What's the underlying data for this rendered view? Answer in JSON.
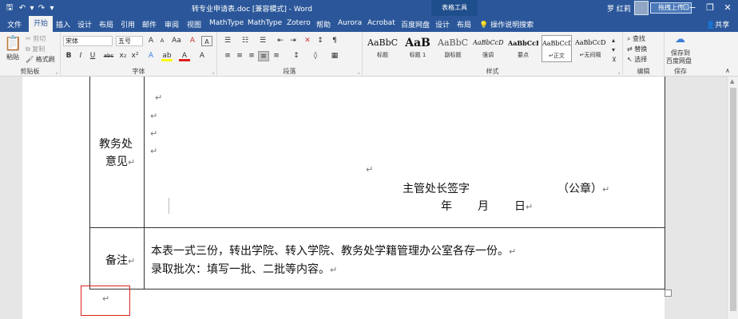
{
  "titlebar": {
    "doc_title": "转专业申请表.doc [兼容模式] - Word",
    "context_title": "表格工具",
    "user": "罗 红莉",
    "upload": "拖拽上传",
    "min": "−",
    "restore": "❐",
    "max": "□",
    "close": "✕"
  },
  "qat": {
    "save": "🖫",
    "undo": "↶",
    "undo_dd": "▾",
    "redo": "↷",
    "customize": "▾"
  },
  "tabs": [
    "文件",
    "开始",
    "插入",
    "设计",
    "布局",
    "引用",
    "邮件",
    "审阅",
    "视图",
    "MathType",
    "MathType",
    "Zotero",
    "帮助",
    "Aurora",
    "Acrobat",
    "百度网盘",
    "设计",
    "布局"
  ],
  "tell_me": "操作说明搜索",
  "share": "共享",
  "clipboard": {
    "paste": "粘贴",
    "cut": "剪切",
    "copy": "复制",
    "format_painter": "格式刷",
    "label": "剪贴板"
  },
  "font": {
    "name": "宋体",
    "size": "五号",
    "label": "字体",
    "grow": "A",
    "shrink": "A",
    "clear": "A",
    "bold": "B",
    "italic": "I",
    "underline": "U",
    "strike": "abc",
    "sub": "x₂",
    "sup": "x²",
    "effects": "A",
    "highlight": "ab",
    "color": "A",
    "aa": "Aa",
    "char": "A"
  },
  "paragraph": {
    "label": "段落",
    "bullets": "☰",
    "numbering": "☷",
    "multilevel": "☰",
    "dec_indent": "⇤",
    "inc_indent": "⇥",
    "sort": "↕",
    "marks": "¶",
    "al_left": "≡",
    "al_center": "≡",
    "al_right": "≡",
    "justify": "≡",
    "distrib": "≡",
    "spacing": "↕",
    "shading": "◊",
    "border": "▦",
    "x": "✕"
  },
  "styles": {
    "label": "样式",
    "items": [
      {
        "sample": "AaBbC",
        "name": "标题"
      },
      {
        "sample": "AaB",
        "name": "标题 1"
      },
      {
        "sample": "AaBbC",
        "name": "副标题"
      },
      {
        "sample": "AaBbCcD",
        "name": "强调"
      },
      {
        "sample": "AaBbCcE",
        "name": "要点"
      },
      {
        "sample": "AaBbCcD",
        "name": "↵正文"
      },
      {
        "sample": "AaBbCcD",
        "name": "↵无间隔"
      }
    ],
    "up": "▴",
    "down": "▾",
    "more": "⊻"
  },
  "editing": {
    "label": "编辑",
    "find": "查找",
    "replace": "替换",
    "select": "选择"
  },
  "save": {
    "label": "保存",
    "line1": "保存到",
    "line2": "百度网盘"
  },
  "table": {
    "dean_label_1": "教务处",
    "dean_label_2": "意见",
    "signature": "主管处长签字",
    "seal": "（公章）",
    "date_year": "年",
    "date_month": "月",
    "date_day": "日",
    "remark_label": "备注",
    "remark_line1": "本表一式三份，转出学院、转入学院、教务处学籍管理办公室各存一份。",
    "remark_line2": "录取批次：填写一批、二批等内容。"
  },
  "marks": {
    "pm": "↵"
  },
  "scroll": {
    "up": "▲"
  }
}
